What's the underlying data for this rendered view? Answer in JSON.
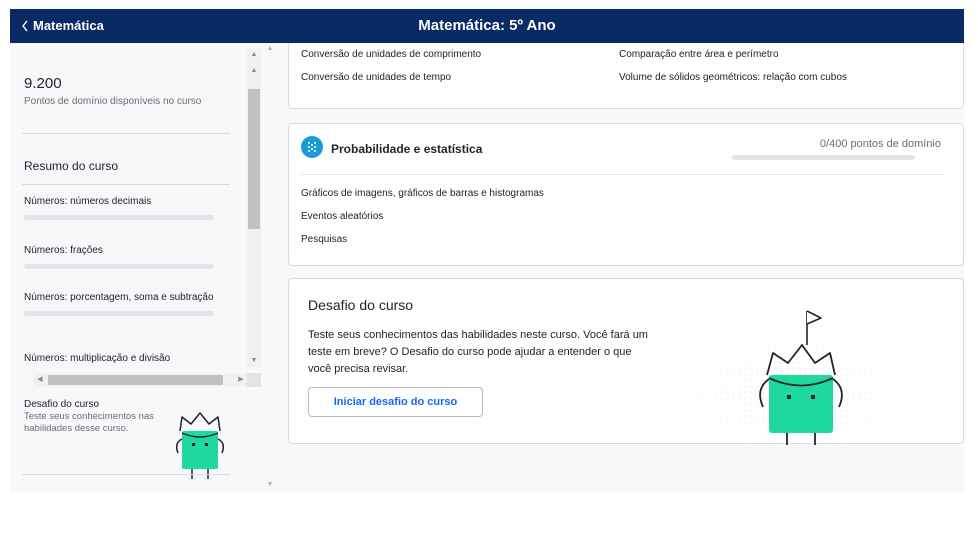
{
  "header": {
    "back_label": "Matemática",
    "title": "Matemática: 5º Ano"
  },
  "sidebar": {
    "points": "9.200",
    "points_desc": "Pontos de domínio disponíveis no curso",
    "summary_title": "Resumo do curso",
    "units": [
      {
        "label": "Números: números decimais",
        "progress": 0
      },
      {
        "label": "Números: frações",
        "progress": 0
      },
      {
        "label": "Números: porcentagem, soma e subtração",
        "progress": 0
      },
      {
        "label": "Números: multiplicação e divisão",
        "progress": 0
      }
    ],
    "challenge_title": "Desafio do curso",
    "challenge_desc": "Teste seus conhecimentos nas habilidades desse curso."
  },
  "measure_card": {
    "skills_left": [
      "Conversão de unidades de comprimento",
      "Conversão de unidades de tempo"
    ],
    "skills_right": [
      "Comparação entre área e perímetro",
      "Volume de sólidos geométricos: relação com cubos"
    ]
  },
  "stats_card": {
    "title": "Probabilidade e estatística",
    "points": "0/400 pontos de domínio",
    "progress": 0,
    "skills": [
      "Gráficos de imagens, gráficos de barras e histogramas",
      "Eventos aleatórios",
      "Pesquisas"
    ]
  },
  "challenge_card": {
    "title": "Desafio do curso",
    "description": "Teste seus conhecimentos das habilidades neste curso. Você fará um teste em breve? O Desafio do curso pode ajudar a entender o que você precisa revisar.",
    "button_label": "Iniciar desafio do curso"
  },
  "colors": {
    "header_bg": "#0a2a66",
    "accent": "#1865f2",
    "robot_green": "#1fd89e",
    "category_icon": "#1a9bd7"
  }
}
